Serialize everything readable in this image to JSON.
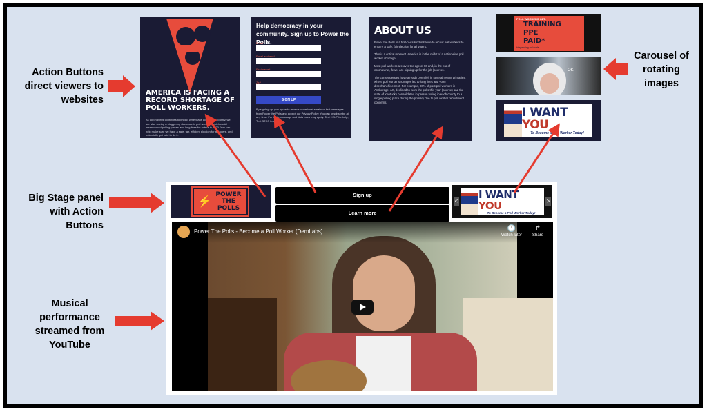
{
  "callouts": {
    "action_buttons": "Action Buttons\ndirect viewers to\nwebsites",
    "carousel": "Carousel of\nrotating\nimages",
    "big_stage": "Big Stage panel\nwith Action\nButtons",
    "musical": "Musical\nperformance\nstreamed from\nYouTube"
  },
  "panel_america": {
    "title": "AMERICA IS FACING A RECORD SHORTAGE OF POLL WORKERS.",
    "body": "As coronavirus continues to impact Americans across the country, we are also seeing a staggering decrease in poll workers, which could mean closed polling places and long lines for voters in 2020. You can help make sure we have a safe, fair, efficient election for all voters, and potentially get paid to do it."
  },
  "panel_signup": {
    "heading": "Help democracy in your community. Sign up to Power the Polls.",
    "fields": [
      "Email*",
      "Email address*",
      "First name*",
      "Zip*"
    ],
    "button": "SIGN UP",
    "body": "By signing up, you agree to receive occasional emails or text messages from Power the Polls and accept our Privacy Policy. You can unsubscribe at any time. For texts, message and data rates may apply. Text HELP for help, Text STOP to quit."
  },
  "panel_about": {
    "heading": "ABOUT US",
    "paragraphs": [
      "Power the Polls is a first-of-its-kind initiative to recruit poll workers to ensure a safe, fair election for all voters.",
      "This is a critical moment. America is in the midst of a nationwide poll worker shortage.",
      "Most poll workers are over the age of 60 and, in the era of coronavirus, fewer are signing up for the job (source).",
      "The consequences have already been felt in several recent primaries, where poll worker shortages led to long lines and voter disenfranchisement. For example, 90% of past poll workers in Anchorage, AK, declined to work the polls this year (source) and the state of Kentucky consolidated in-person voting in each county to a single polling place during the primary due to poll worker recruitment concerns."
    ]
  },
  "carousel_ad": {
    "header": "POLL WORKERS GET:",
    "items": [
      "TRAINING",
      "PPE",
      "PAID*"
    ],
    "footnote": "*depending on locale"
  },
  "carousel_photo_caption": "OK",
  "i_want_you": {
    "big_a": "I WANT ",
    "big_b": "YOU",
    "small": "To Become a Poll Worker Today!"
  },
  "stage": {
    "logo_line1": "POWER",
    "logo_line2": "THE POLLS",
    "signup_button": "Sign up",
    "learn_button": "Learn more",
    "nav_prev": "<",
    "nav_next": ">"
  },
  "video": {
    "title": "Power The Polls - Become a Poll Worker (DemLabs)",
    "watch_later": "Watch later",
    "share": "Share",
    "watch_later_icon": "clock-icon",
    "share_icon": "share-arrow-icon"
  },
  "colors": {
    "annotation_red": "#e53b2f",
    "brand_navy": "#1a1b34",
    "brand_coral": "#e74c3c",
    "signup_blue": "#3549c6",
    "slide_background": "#d9e2ef"
  }
}
